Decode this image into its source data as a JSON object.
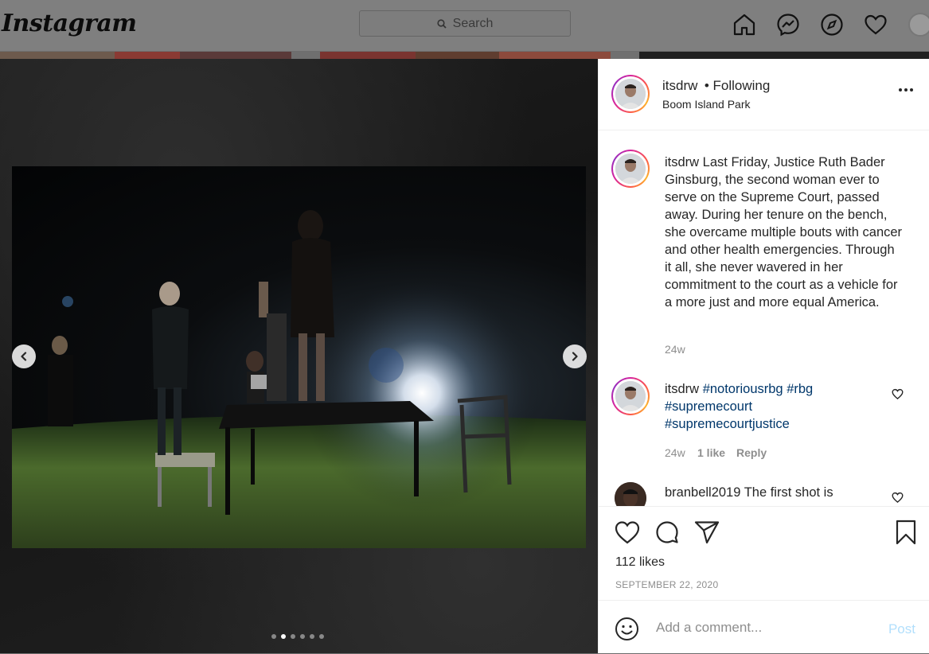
{
  "header": {
    "logo": "Instagram",
    "search_placeholder": "Search"
  },
  "post": {
    "username": "itsdrw",
    "follow_status": "• Following",
    "location": "Boom Island Park",
    "caption": {
      "username": "itsdrw",
      "text": " Last Friday, Justice Ruth Bader Ginsburg, the second woman ever to serve on the Supreme Court, passed away.  During her tenure on the bench, she overcame multiple bouts with cancer and other health emergencies. Through it all, she never wavered in her commitment to the court as a vehicle for a more just and more equal America.",
      "time": "24w"
    },
    "comments": [
      {
        "username": "itsdrw",
        "hashtags": [
          "#notoriousrbg",
          "#rbg",
          "#supremecourt",
          "#supremecourtjustice"
        ],
        "time": "24w",
        "likes": "1 like",
        "reply": "Reply"
      },
      {
        "username": "branbell2019",
        "text": " The first shot is"
      }
    ],
    "likes": "112 likes",
    "date": "SEPTEMBER 22, 2020",
    "comment_placeholder": "Add a comment...",
    "post_button": "Post"
  },
  "carousel": {
    "total": 6,
    "active_index": 1
  }
}
